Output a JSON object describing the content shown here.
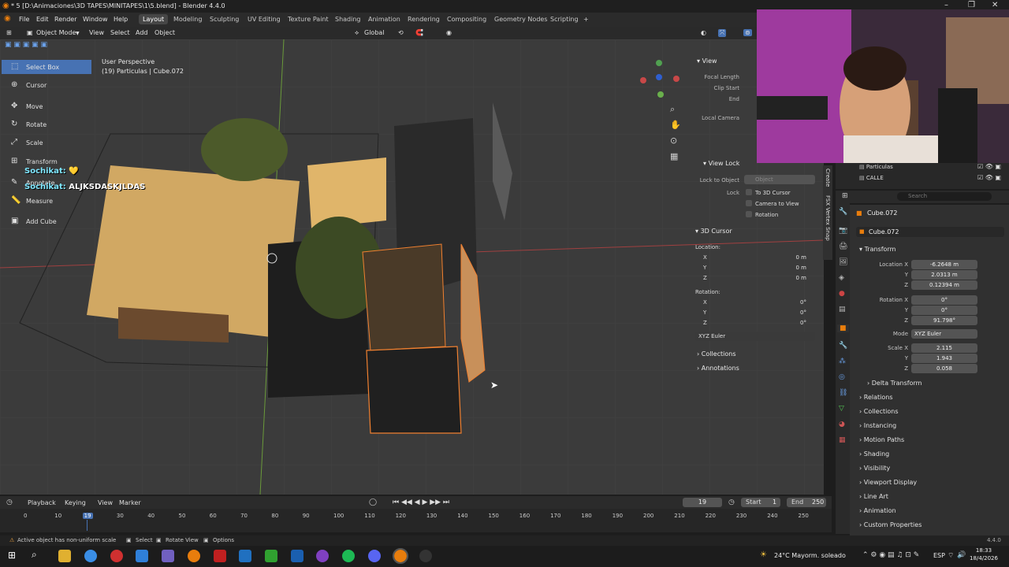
{
  "window": {
    "title": "* 5 [D:\\Animaciones\\3D TAPES\\MINITAPES\\1\\5.blend] - Blender 4.4.0",
    "controls": [
      "–",
      "❐",
      "✕"
    ]
  },
  "menu": {
    "items": [
      "File",
      "Edit",
      "Render",
      "Window",
      "Help"
    ],
    "workspaces": [
      "Layout",
      "Modeling",
      "Sculpting",
      "UV Editing",
      "Texture Paint",
      "Shading",
      "Animation",
      "Rendering",
      "Compositing",
      "Geometry Nodes",
      "Scripting"
    ],
    "active_workspace": "Layout",
    "add_tab": "+"
  },
  "viewport_header": {
    "mode": "Object Mode",
    "menus": [
      "View",
      "Select",
      "Add",
      "Object"
    ],
    "orientation": "Global"
  },
  "toolbar": {
    "tools": [
      {
        "label": "Select Box",
        "icon": "select-box-icon",
        "glyph": "⬚",
        "active": true
      },
      {
        "label": "Cursor",
        "icon": "cursor-icon",
        "glyph": "⊕",
        "active": false
      },
      {
        "label": "Move",
        "icon": "move-icon",
        "glyph": "✥",
        "active": false
      },
      {
        "label": "Rotate",
        "icon": "rotate-icon",
        "glyph": "↻",
        "active": false
      },
      {
        "label": "Scale",
        "icon": "scale-icon",
        "glyph": "⤢",
        "active": false
      },
      {
        "label": "Transform",
        "icon": "transform-icon",
        "glyph": "⊞",
        "active": false
      },
      {
        "label": "Annotate",
        "icon": "annotate-icon",
        "glyph": "✎",
        "active": false
      },
      {
        "label": "Measure",
        "icon": "measure-icon",
        "glyph": "📏",
        "active": false
      },
      {
        "label": "Add Cube",
        "icon": "add-cube-icon",
        "glyph": "▣",
        "active": false
      }
    ]
  },
  "viewport": {
    "perspective": "User Perspective",
    "context": "(19) Particulas | Cube.072"
  },
  "chat": [
    {
      "user": "Sochikat:",
      "message": "💛"
    },
    {
      "user": "Sochikat:",
      "message": "ALJKSDASKJLDAS"
    }
  ],
  "npanel": {
    "view_header": "View",
    "focal_length_label": "Focal Length",
    "clip_start_label": "Clip Start",
    "end_label": "End",
    "local_camera_label": "Local Camera",
    "view_lock_header": "View Lock",
    "lock_to_object_label": "Lock to Object",
    "lock_to_object_placeholder": "Object",
    "lock_label": "Lock",
    "lock_options": [
      "To 3D Cursor",
      "Camera to View",
      "Rotation"
    ],
    "cursor_header": "3D Cursor",
    "location_label": "Location:",
    "location": [
      {
        "axis": "X",
        "value": "0 m"
      },
      {
        "axis": "Y",
        "value": "0 m"
      },
      {
        "axis": "Z",
        "value": "0 m"
      }
    ],
    "rotation_label": "Rotation:",
    "rotation": [
      {
        "axis": "X",
        "value": "0°"
      },
      {
        "axis": "Y",
        "value": "0°"
      },
      {
        "axis": "Z",
        "value": "0°"
      }
    ],
    "rotation_mode": "XYZ Euler",
    "collections_label": "Collections",
    "annotations_label": "Annotations",
    "side_tabs": [
      "Create",
      "FSX Vertex Snap"
    ]
  },
  "outliner": {
    "rows": [
      {
        "name": "Particulas"
      },
      {
        "name": "CALLE"
      }
    ]
  },
  "properties": {
    "search_placeholder": "Search",
    "object_name": "Cube.072",
    "object_datablock": "Cube.072",
    "transform_header": "Transform",
    "location_label": "Location X",
    "location": [
      "-6.2648 m",
      "2.0313 m",
      "0.12394 m"
    ],
    "rotation_label": "Rotation X",
    "rotation": [
      "0°",
      "0°",
      "91.798°"
    ],
    "mode_label": "Mode",
    "mode": "XYZ Euler",
    "scale_label": "Scale X",
    "scale": [
      "2.115",
      "1.943",
      "0.058"
    ],
    "axis_y": "Y",
    "axis_z": "Z",
    "sections": [
      "Delta Transform",
      "Relations",
      "Collections",
      "Instancing",
      "Motion Paths",
      "Shading",
      "Visibility",
      "Viewport Display",
      "Line Art",
      "Animation",
      "Custom Properties"
    ]
  },
  "timeline": {
    "menus": [
      "Playback",
      "Keying",
      "View",
      "Marker"
    ],
    "current_frame": "19",
    "start_label": "Start",
    "start": "1",
    "end_label": "End",
    "end": "250",
    "ticks": [
      "0",
      "10",
      "19",
      "30",
      "40",
      "50",
      "60",
      "70",
      "80",
      "90",
      "100",
      "110",
      "120",
      "130",
      "140",
      "150",
      "160",
      "170",
      "180",
      "190",
      "200",
      "210",
      "220",
      "230",
      "240",
      "250"
    ]
  },
  "statusbar": {
    "warning": "Active object has non-uniform scale",
    "hints": [
      "Select",
      "Rotate View",
      "Options"
    ],
    "version": "4.4.0"
  },
  "taskbar": {
    "weather": "24°C  Mayorm. soleado",
    "language": "ESP",
    "time": "18:33",
    "date": "18/4/2026"
  },
  "colors": {
    "accent": "#4772b3",
    "selection": "#f08030",
    "chat_name": "#7fe7ff"
  }
}
